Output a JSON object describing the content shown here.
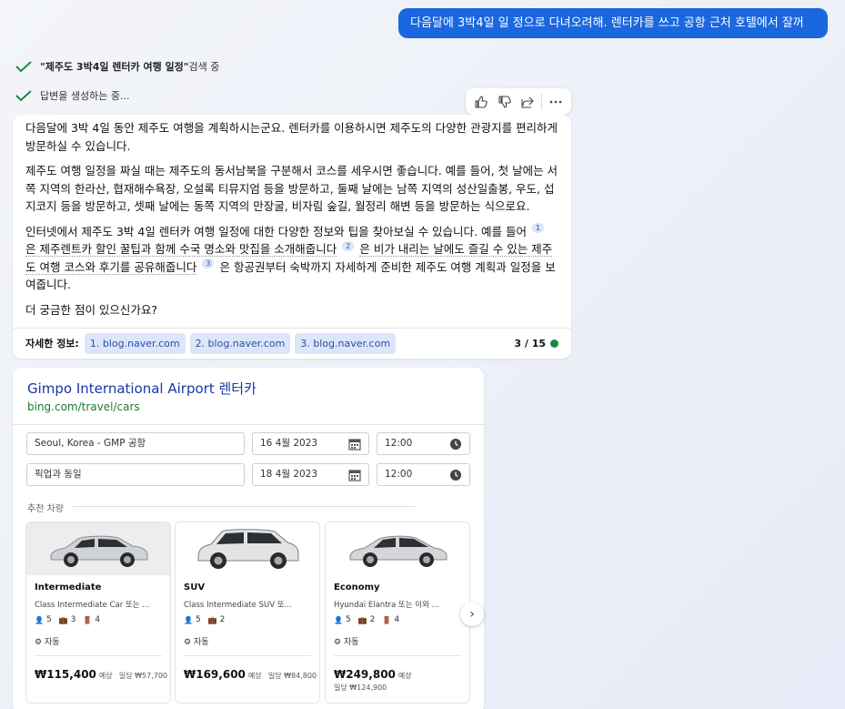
{
  "user_message": "다음달에 3박4일 일 정으로 다녀오려해. 렌터카를 쓰고 공항 근처 호텔에서 잘꺼",
  "status": {
    "search_query": "\"제주도 3박4일 렌터카 여행 일정\"",
    "search_suffix": " 검색 중",
    "generating": "답변을 생성하는 중..."
  },
  "toolbar": {
    "like_icon": "thumbs-up-icon",
    "dislike_icon": "thumbs-down-icon",
    "share_icon": "share-icon",
    "more_icon": "more-icon"
  },
  "answer": {
    "p1": "다음달에 3박 4일 동안 제주도 여행을 계획하시는군요. 렌터카를 이용하시면 제주도의 다양한 관광지를 편리하게 방문하실 수 있습니다.",
    "p2": "제주도 여행 일정을 짜실 때는 제주도의 동서남북을 구분해서 코스를 세우시면 좋습니다. 예를 들어, 첫 날에는 서쪽 지역의 한라산, 협재해수욕장, 오설록 티뮤지엄 등을 방문하고, 둘째 날에는 남쪽 지역의 성산일출봉, 우도, 섭지코지 등을 방문하고, 셋째 날에는 동쪽 지역의 만장굴, 비자림 숲길, 월정리 해변 등을 방문하는 식으로요.",
    "p3_a": "인터넷에서 제주도 3박 4일 렌터카 여행 일정에 대한 다양한 정보와 팁을 찾아보실 수 있습니다. 예를 들어",
    "cite1": "1",
    "p3_b": "은 제주렌트카 할인 꿀팁과 함께 수국 명소와 맛집을 소개해줍니다",
    "cite2": "2",
    "p3_c": "은 비가 내리는 날에도 즐길 수 있는 제주도 여행 코스와 후기를 공유해줍니다",
    "cite3": "3",
    "p3_d": "은 항공권부터 숙박까지 자세하게 준비한 제주도 여행 계획과 일정을 보여줍니다.",
    "p4": "더 궁금한 점이 있으신가요?",
    "learn_more_label": "자세한 정보:",
    "links": [
      "1. blog.naver.com",
      "2. blog.naver.com",
      "3. blog.naver.com"
    ],
    "counter": "3 / 15",
    "counter_color": "#1a8a3f"
  },
  "card": {
    "title": "Gimpo International Airport 렌터카",
    "url": "bing.com/travel/cars",
    "pickup_location": "Seoul, Korea - GMP 공항",
    "pickup_date": "16 4월 2023",
    "pickup_time": "12:00",
    "return_location": "픽업과 동일",
    "return_date": "18 4월 2023",
    "return_time": "12:00",
    "section_label": "추천 차량",
    "cars": [
      {
        "name": "Intermediate",
        "desc": "Class Intermediate Car 또는 ...",
        "seats": "5",
        "bags": "3",
        "doors": "4",
        "trans": "자동",
        "price": "₩115,400",
        "price_note": "예상",
        "daily": "일당 ₩57,700"
      },
      {
        "name": "SUV",
        "desc": "Class Intermediate SUV 또...",
        "seats": "5",
        "bags": "2",
        "doors": "",
        "trans": "자동",
        "price": "₩169,600",
        "price_note": "예상",
        "daily": "일당 ₩84,800"
      },
      {
        "name": "Economy",
        "desc": "Hyundai Elantra 또는 이와 ...",
        "seats": "5",
        "bags": "2",
        "doors": "4",
        "trans": "자동",
        "price": "₩249,800",
        "price_note": "예상",
        "daily": "일당 ₩124,900"
      }
    ]
  }
}
